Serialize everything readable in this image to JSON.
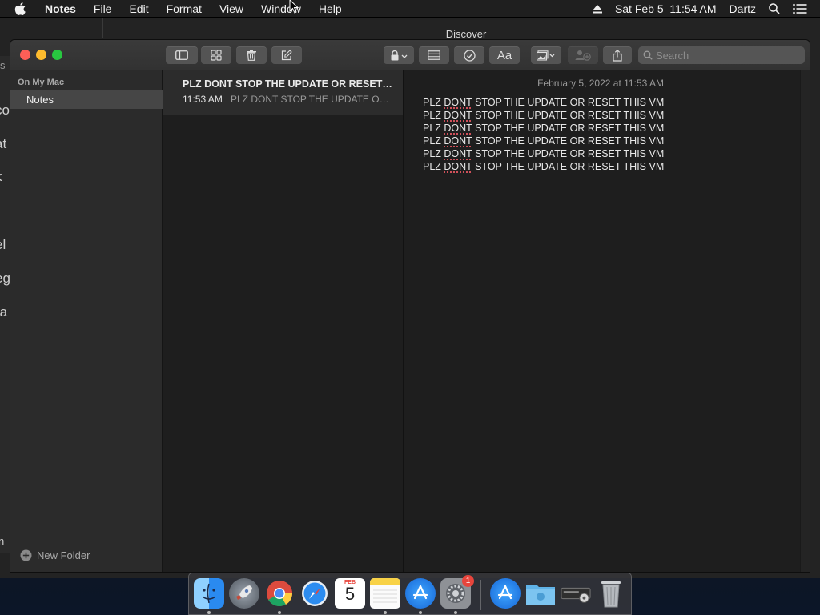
{
  "menubar": {
    "app_name": "Notes",
    "menus": [
      "File",
      "Edit",
      "Format",
      "View",
      "Window",
      "Help"
    ],
    "clock": "Sat Feb 5  11:54 AM",
    "user": "Dartz"
  },
  "background_window": {
    "title": "Discover",
    "fragments": [
      "s",
      "co",
      "at",
      "k",
      "el",
      "eg",
      "ra",
      "n"
    ]
  },
  "notes_window": {
    "search_placeholder": "Search",
    "sidebar": {
      "section": "On My Mac",
      "selected_folder": "Notes",
      "new_folder_label": "New Folder"
    },
    "note_list": [
      {
        "title": "PLZ DONT STOP THE UPDATE OR RESET THIS VM",
        "time": "11:53 AM",
        "preview": "PLZ DONT STOP THE UPDATE OR RESET THIS VM"
      }
    ],
    "editor": {
      "date": "February 5, 2022 at 11:53 AM",
      "lines": [
        {
          "pre": "PLZ ",
          "misspelled": "DONT",
          "post": " STOP THE UPDATE OR RESET THIS VM"
        },
        {
          "pre": "PLZ ",
          "misspelled": "DONT",
          "post": " STOP THE UPDATE OR RESET THIS VM"
        },
        {
          "pre": "PLZ ",
          "misspelled": "DONT",
          "post": " STOP THE UPDATE OR RESET THIS VM"
        },
        {
          "pre": "PLZ ",
          "misspelled": "DONT",
          "post": " STOP THE UPDATE OR RESET THIS VM"
        },
        {
          "pre": "PLZ ",
          "misspelled": "DONT",
          "post": " STOP THE UPDATE OR RESET THIS VM"
        },
        {
          "pre": "PLZ ",
          "misspelled": "DONT",
          "post": " STOP THE UPDATE OR RESET THIS VM"
        }
      ]
    }
  },
  "dock": {
    "calendar_month": "FEB",
    "calendar_day": "5",
    "system_prefs_badge": "1",
    "items": [
      "finder-icon",
      "launchpad-icon",
      "chrome-icon",
      "safari-icon",
      "calendar-icon",
      "notes-icon",
      "app-store-icon",
      "system-preferences-icon",
      "app-store-downloads-icon",
      "folder-icon",
      "disk-utility-icon",
      "trash-icon"
    ]
  },
  "colors": {
    "accent": "#2f7bf5",
    "close": "#fe5f57",
    "minimize": "#febc2e",
    "maximize": "#28c840",
    "spell_underline": "#d0505a"
  }
}
